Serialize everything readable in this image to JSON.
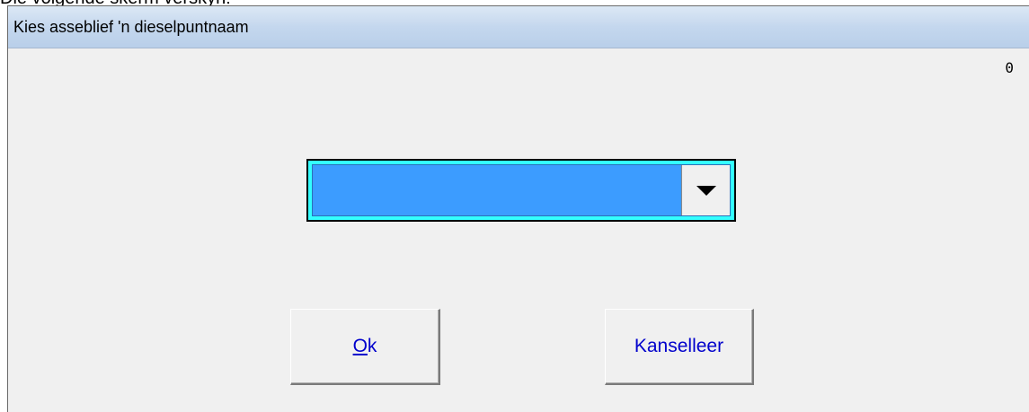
{
  "top_caption": "Die volgende skerm verskyn:",
  "dialog": {
    "title": "Kies asseblief 'n dieselpuntnaam",
    "counter": "0"
  },
  "combo": {
    "selected_value": "",
    "dropdown_icon": "triangle-down-icon"
  },
  "buttons": {
    "ok_mnemonic": "O",
    "ok_rest": "k",
    "cancel_label": "Kanselleer"
  },
  "colors": {
    "combo_fill": "#3c9cff",
    "combo_ring": "#33ffff",
    "button_text": "#0000cc",
    "titlebar": "#c4d7ee"
  }
}
